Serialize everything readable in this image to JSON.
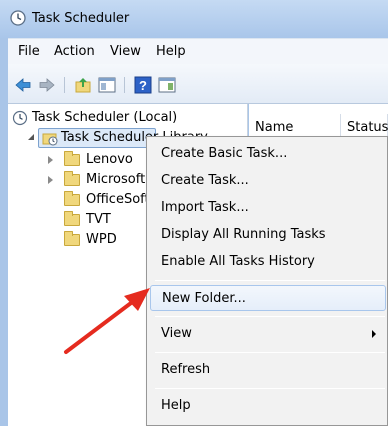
{
  "window": {
    "title": "Task Scheduler"
  },
  "menubar": {
    "items": [
      "File",
      "Action",
      "View",
      "Help"
    ]
  },
  "toolbar": {
    "buttons": [
      "back-icon",
      "forward-icon",
      "up-folder-icon",
      "show-hide-console-tree-icon",
      "help-icon",
      "show-hide-action-pane-icon"
    ]
  },
  "tree": {
    "root": "Task Scheduler (Local)",
    "library": "Task Scheduler Library",
    "children": [
      "Lenovo",
      "Microsoft",
      "OfficeSoftwareProtectionPlatform",
      "TVT",
      "WPD"
    ]
  },
  "list": {
    "columns": [
      "Name",
      "Status"
    ]
  },
  "context_menu": {
    "items": [
      {
        "label": "Create Basic Task..."
      },
      {
        "label": "Create Task..."
      },
      {
        "label": "Import Task..."
      },
      {
        "label": "Display All Running Tasks"
      },
      {
        "label": "Enable All Tasks History"
      },
      {
        "label": "New Folder...",
        "highlighted": true
      },
      {
        "label": "View",
        "submenu": true
      },
      {
        "label": "Refresh"
      },
      {
        "label": "Help"
      }
    ]
  },
  "colors": {
    "arrow": "#e52b1f",
    "title_bar": "#a9c6ea",
    "highlight_border": "#a8c6ec"
  }
}
